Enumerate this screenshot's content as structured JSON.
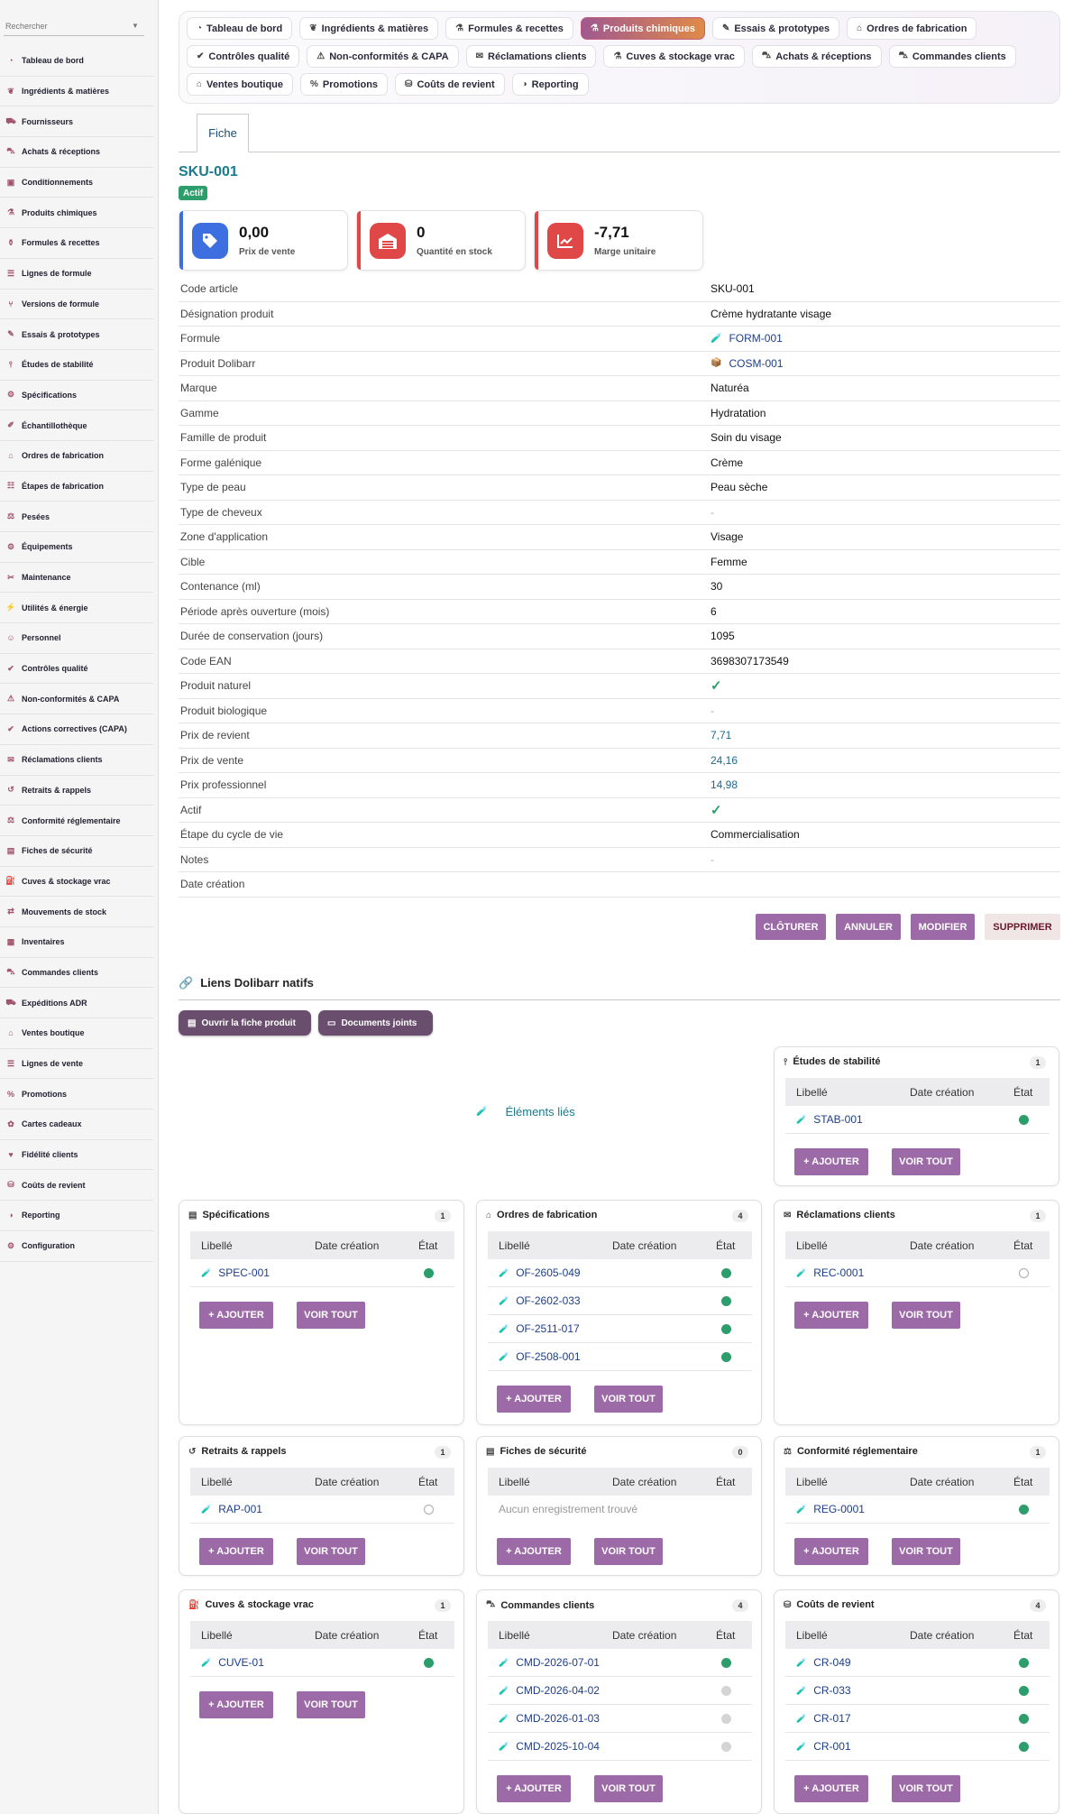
{
  "sidebar": {
    "search_placeholder": "Rechercher",
    "items": [
      {
        "label": "Tableau de bord",
        "icon": "gauge-icon"
      },
      {
        "label": "Ingrédients & matières",
        "icon": "leaf-icon"
      },
      {
        "label": "Fournisseurs",
        "icon": "truck-icon"
      },
      {
        "label": "Achats & réceptions",
        "icon": "cart-icon"
      },
      {
        "label": "Conditionnements",
        "icon": "box-icon"
      },
      {
        "label": "Produits chimiques",
        "icon": "flask-icon"
      },
      {
        "label": "Formules & recettes",
        "icon": "beaker-icon"
      },
      {
        "label": "Lignes de formule",
        "icon": "list-icon"
      },
      {
        "label": "Versions de formule",
        "icon": "branch-icon"
      },
      {
        "label": "Essais & prototypes",
        "icon": "pipette-icon"
      },
      {
        "label": "Études de stabilité",
        "icon": "thermometer-icon"
      },
      {
        "label": "Spécifications",
        "icon": "gear-icon"
      },
      {
        "label": "Échantillothèque",
        "icon": "vial-icon"
      },
      {
        "label": "Ordres de fabrication",
        "icon": "factory-icon"
      },
      {
        "label": "Étapes de fabrication",
        "icon": "steps-icon"
      },
      {
        "label": "Pesées",
        "icon": "scale-icon"
      },
      {
        "label": "Équipements",
        "icon": "cogs-icon"
      },
      {
        "label": "Maintenance",
        "icon": "tools-icon"
      },
      {
        "label": "Utilités & énergie",
        "icon": "bolt-icon"
      },
      {
        "label": "Personnel",
        "icon": "users-icon"
      },
      {
        "label": "Contrôles qualité",
        "icon": "check-icon"
      },
      {
        "label": "Non-conformités & CAPA",
        "icon": "warning-icon"
      },
      {
        "label": "Actions correctives (CAPA)",
        "icon": "check-icon"
      },
      {
        "label": "Réclamations clients",
        "icon": "comment-icon"
      },
      {
        "label": "Retraits & rappels",
        "icon": "undo-icon"
      },
      {
        "label": "Conformité réglementaire",
        "icon": "balance-icon"
      },
      {
        "label": "Fiches de sécurité",
        "icon": "file-icon"
      },
      {
        "label": "Cuves & stockage vrac",
        "icon": "tank-icon"
      },
      {
        "label": "Mouvements de stock",
        "icon": "arrows-icon"
      },
      {
        "label": "Inventaires",
        "icon": "inventory-icon"
      },
      {
        "label": "Commandes clients",
        "icon": "cart-icon"
      },
      {
        "label": "Expéditions ADR",
        "icon": "truck-icon"
      },
      {
        "label": "Ventes boutique",
        "icon": "store-icon"
      },
      {
        "label": "Lignes de vente",
        "icon": "list-icon"
      },
      {
        "label": "Promotions",
        "icon": "percent-icon"
      },
      {
        "label": "Cartes cadeaux",
        "icon": "gift-icon"
      },
      {
        "label": "Fidélité clients",
        "icon": "heart-icon"
      },
      {
        "label": "Coûts de revient",
        "icon": "coins-icon"
      },
      {
        "label": "Reporting",
        "icon": "chart-icon"
      },
      {
        "label": "Configuration",
        "icon": "gear-icon"
      }
    ]
  },
  "topnav": {
    "rows": [
      [
        {
          "label": "Tableau de bord"
        },
        {
          "label": "Ingrédients & matières"
        },
        {
          "label": "Formules & recettes"
        },
        {
          "label": "Produits chimiques",
          "active": true
        },
        {
          "label": "Essais & prototypes"
        },
        {
          "label": "Ordres de fabrication"
        }
      ],
      [
        {
          "label": "Contrôles qualité"
        },
        {
          "label": "Non-conformités & CAPA"
        },
        {
          "label": "Réclamations clients"
        },
        {
          "label": "Cuves & stockage vrac"
        },
        {
          "label": "Achats & réceptions"
        },
        {
          "label": "Commandes clients"
        }
      ],
      [
        {
          "label": "Ventes boutique"
        },
        {
          "label": "Promotions"
        },
        {
          "label": "Coûts de revient"
        },
        {
          "label": "Reporting"
        }
      ]
    ]
  },
  "subtab": "Fiche",
  "record": {
    "ref": "SKU-001",
    "status": "Actif"
  },
  "kpis": [
    {
      "value": "0,00",
      "label": "Prix de vente",
      "color": "#3d6fe0",
      "icon": "tag-icon"
    },
    {
      "value": "0",
      "label": "Quantité en stock",
      "color": "#e04848",
      "icon": "warehouse-icon"
    },
    {
      "value": "-7,71",
      "label": "Marge unitaire",
      "color": "#e04848",
      "icon": "chart-line-icon"
    }
  ],
  "fields": [
    {
      "label": "Code article",
      "value": "SKU-001"
    },
    {
      "label": "Désignation produit",
      "value": "Crème hydratante visage"
    },
    {
      "label": "Formule",
      "value": "FORM-001",
      "type": "link-icon"
    },
    {
      "label": "Produit Dolibarr",
      "value": "COSM-001",
      "type": "link-box"
    },
    {
      "label": "Marque",
      "value": "Naturéa"
    },
    {
      "label": "Gamme",
      "value": "Hydratation"
    },
    {
      "label": "Famille de produit",
      "value": "Soin du visage"
    },
    {
      "label": "Forme galénique",
      "value": "Crème"
    },
    {
      "label": "Type de peau",
      "value": "Peau sèche"
    },
    {
      "label": "Type de cheveux",
      "value": "-",
      "type": "dash"
    },
    {
      "label": "Zone d'application",
      "value": "Visage"
    },
    {
      "label": "Cible",
      "value": "Femme"
    },
    {
      "label": "Contenance (ml)",
      "value": "30"
    },
    {
      "label": "Période après ouverture (mois)",
      "value": "6"
    },
    {
      "label": "Durée de conservation (jours)",
      "value": "1095"
    },
    {
      "label": "Code EAN",
      "value": "3698307173549"
    },
    {
      "label": "Produit naturel",
      "value": "✓",
      "type": "check"
    },
    {
      "label": "Produit biologique",
      "value": "-",
      "type": "dash"
    },
    {
      "label": "Prix de revient",
      "value": "7,71",
      "type": "num"
    },
    {
      "label": "Prix de vente",
      "value": "24,16",
      "type": "num"
    },
    {
      "label": "Prix professionnel",
      "value": "14,98",
      "type": "num"
    },
    {
      "label": "Actif",
      "value": "✓",
      "type": "check"
    },
    {
      "label": "Étape du cycle de vie",
      "value": "Commercialisation"
    },
    {
      "label": "Notes",
      "value": "-",
      "type": "dash"
    },
    {
      "label": "Date création",
      "value": ""
    }
  ],
  "actions": {
    "close": "CLÔTURER",
    "cancel": "ANNULER",
    "edit": "MODIFIER",
    "delete": "SUPPRIMER"
  },
  "dolibarr": {
    "title": "Liens Dolibarr natifs",
    "open_product": "Ouvrir la fiche produit",
    "attachments": "Documents joints",
    "linked": "Éléments liés"
  },
  "table_headers": {
    "label": "Libellé",
    "date": "Date création",
    "state": "État"
  },
  "panel_buttons": {
    "add": "+ AJOUTER",
    "view_all": "VOIR TOUT"
  },
  "panels": [
    {
      "key": "stab",
      "title": "Études de stabilité",
      "count": "1",
      "icon": "thermometer-icon",
      "rows": [
        {
          "ref": "STAB-001",
          "state": "green"
        }
      ]
    },
    {
      "key": "spec",
      "title": "Spécifications",
      "count": "1",
      "icon": "clipboard-icon",
      "rows": [
        {
          "ref": "SPEC-001",
          "state": "green"
        }
      ]
    },
    {
      "key": "of",
      "title": "Ordres de fabrication",
      "count": "4",
      "icon": "factory-icon",
      "rows": [
        {
          "ref": "OF-2605-049",
          "state": "green"
        },
        {
          "ref": "OF-2602-033",
          "state": "green"
        },
        {
          "ref": "OF-2511-017",
          "state": "green"
        },
        {
          "ref": "OF-2508-001",
          "state": "green"
        }
      ]
    },
    {
      "key": "rec",
      "title": "Réclamations clients",
      "count": "1",
      "icon": "comment-icon",
      "rows": [
        {
          "ref": "REC-0001",
          "state": "empty"
        }
      ]
    },
    {
      "key": "rap",
      "title": "Retraits & rappels",
      "count": "1",
      "icon": "undo-icon",
      "rows": [
        {
          "ref": "RAP-001",
          "state": "empty"
        }
      ]
    },
    {
      "key": "fds",
      "title": "Fiches de sécurité",
      "count": "0",
      "icon": "file-icon",
      "rows": [],
      "empty": "Aucun enregistrement trouvé"
    },
    {
      "key": "reg",
      "title": "Conformité réglementaire",
      "count": "1",
      "icon": "balance-icon",
      "rows": [
        {
          "ref": "REG-0001",
          "state": "green"
        }
      ]
    },
    {
      "key": "cuve",
      "title": "Cuves & stockage vrac",
      "count": "1",
      "icon": "tank-icon",
      "rows": [
        {
          "ref": "CUVE-01",
          "state": "green"
        }
      ]
    },
    {
      "key": "cmd",
      "title": "Commandes clients",
      "count": "4",
      "icon": "cart-icon",
      "rows": [
        {
          "ref": "CMD-2026-07-01",
          "state": "green"
        },
        {
          "ref": "CMD-2026-04-02",
          "state": "grey"
        },
        {
          "ref": "CMD-2026-01-03",
          "state": "grey"
        },
        {
          "ref": "CMD-2025-10-04",
          "state": "grey"
        }
      ]
    },
    {
      "key": "cr",
      "title": "Coûts de revient",
      "count": "4",
      "icon": "coins-icon",
      "rows": [
        {
          "ref": "CR-049",
          "state": "green"
        },
        {
          "ref": "CR-033",
          "state": "green"
        },
        {
          "ref": "CR-017",
          "state": "green"
        },
        {
          "ref": "CR-001",
          "state": "green"
        }
      ]
    }
  ]
}
